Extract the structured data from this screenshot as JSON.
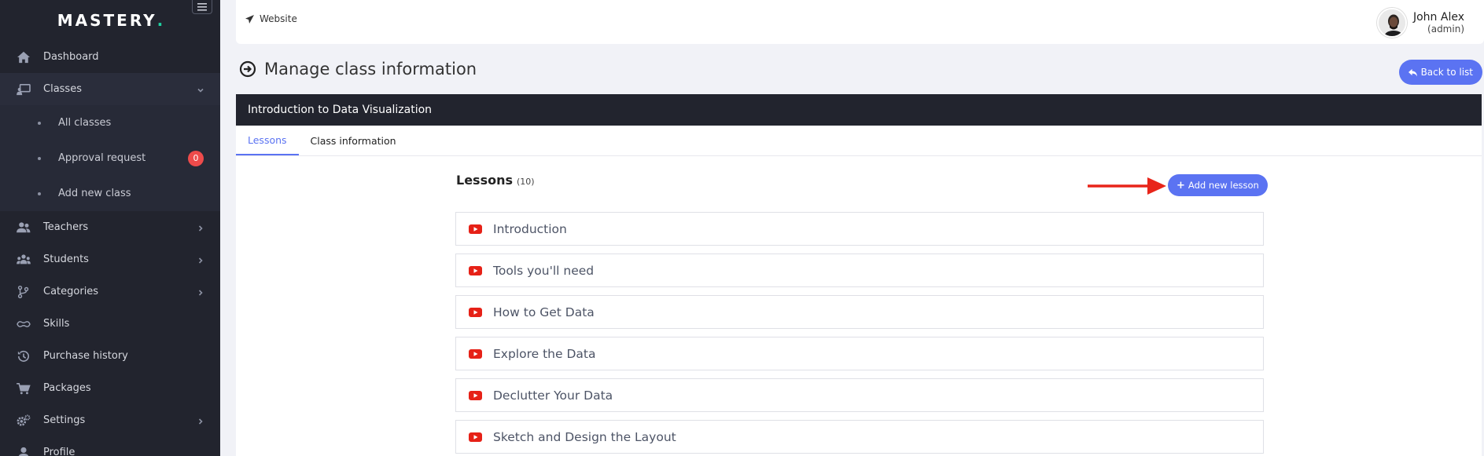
{
  "brand": {
    "name": "MASTERY",
    "dot": "."
  },
  "sidebar": {
    "items": [
      {
        "label": "Dashboard",
        "icon": "home-icon"
      },
      {
        "label": "Classes",
        "icon": "classes-icon",
        "active": true,
        "expanded": true
      },
      {
        "label": "Teachers",
        "icon": "teachers-icon"
      },
      {
        "label": "Students",
        "icon": "students-icon"
      },
      {
        "label": "Categories",
        "icon": "categories-icon"
      },
      {
        "label": "Skills",
        "icon": "skills-icon"
      },
      {
        "label": "Purchase history",
        "icon": "history-icon"
      },
      {
        "label": "Packages",
        "icon": "cart-icon"
      },
      {
        "label": "Settings",
        "icon": "gear-icon"
      },
      {
        "label": "Profile",
        "icon": "user-icon"
      }
    ],
    "submenu": [
      {
        "label": "All classes"
      },
      {
        "label": "Approval request",
        "badge": "0"
      },
      {
        "label": "Add new class"
      }
    ]
  },
  "topbar": {
    "website_label": "Website",
    "user_name": "John Alex",
    "user_role": "(admin)"
  },
  "page": {
    "title": "Manage class information",
    "back_label": "Back to list"
  },
  "card": {
    "title": "Introduction to Data Visualization",
    "tabs": [
      {
        "label": "Lessons",
        "active": true
      },
      {
        "label": "Class information",
        "active": false
      }
    ]
  },
  "lessons": {
    "title": "Lessons",
    "count": "(10)",
    "add_label": "Add new lesson",
    "items": [
      {
        "label": "Introduction"
      },
      {
        "label": "Tools you'll need"
      },
      {
        "label": "How to Get Data"
      },
      {
        "label": "Explore the Data"
      },
      {
        "label": "Declutter Your Data"
      },
      {
        "label": "Sketch and Design the Layout"
      }
    ]
  },
  "colors": {
    "sidebar_bg": "#22242e",
    "accent": "#5b73f2",
    "badge": "#ee4b4b",
    "youtube": "#e62117",
    "brand_dot": "#1fd1a0",
    "annotation_arrow": "#e8251a"
  }
}
